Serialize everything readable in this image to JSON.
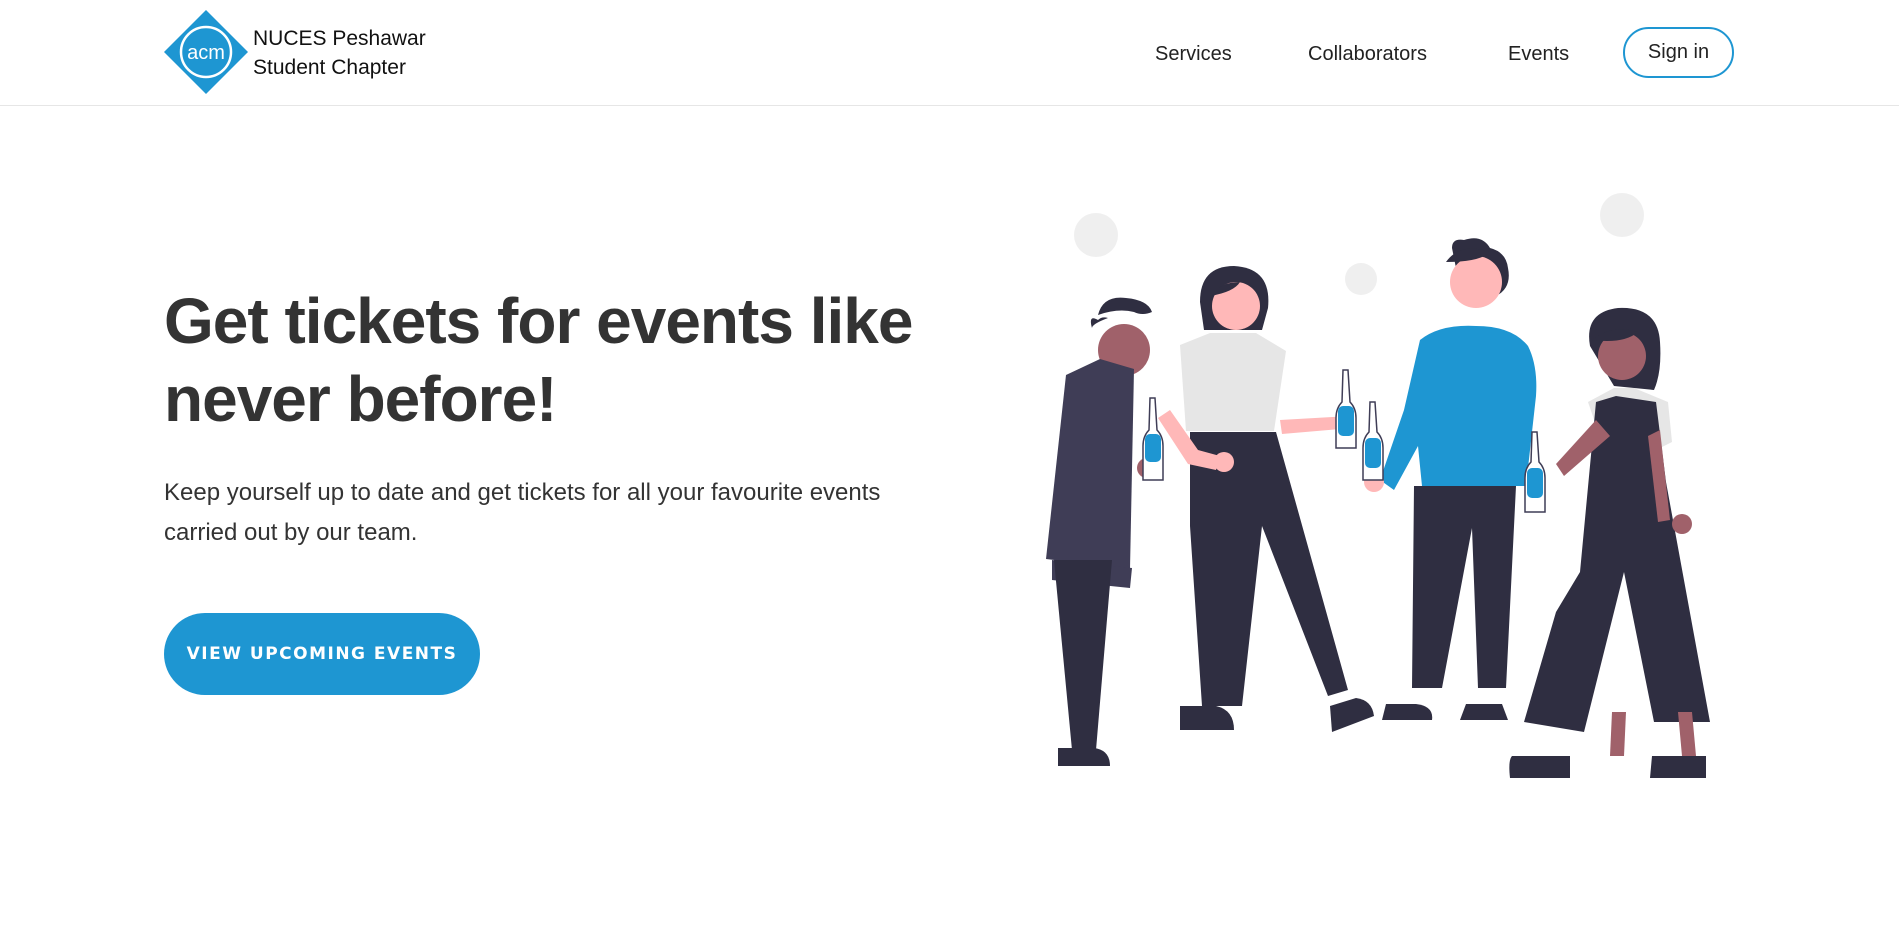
{
  "navbar": {
    "logo_text": "acm",
    "brand_line1": "NUCES Peshawar",
    "brand_line2": "Student Chapter",
    "links": [
      "Services",
      "Collaborators",
      "Events"
    ],
    "signin_label": "Sign in"
  },
  "hero": {
    "title_line1": "Get tickets for events like",
    "title_line2": "never before!",
    "subtitle_line1": "Keep yourself up to date and get tickets for all your favourite events",
    "subtitle_line2": "carried out by our team.",
    "cta_label": "VIEW UPCOMING EVENTS"
  },
  "colors": {
    "accent": "#1e96d2",
    "text": "#333333",
    "figure_dark": "#2f2e41",
    "skin_light": "#ffb8b8",
    "skin_dark": "#a0616a",
    "shirt_grey": "#e6e6e6",
    "bubble": "#efefef"
  },
  "illustration": {
    "icon": "people-toasting-illustration"
  }
}
